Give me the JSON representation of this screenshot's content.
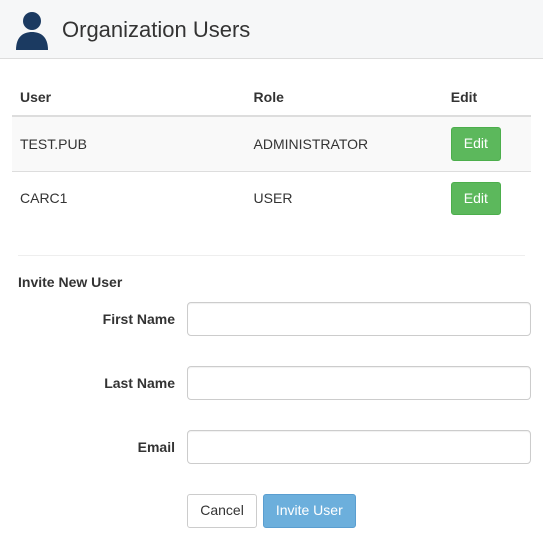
{
  "header": {
    "title": "Organization Users"
  },
  "table": {
    "columns": {
      "user": "User",
      "role": "Role",
      "edit": "Edit"
    },
    "rows": [
      {
        "user": "TEST.PUB",
        "role": "ADMINISTRATOR",
        "edit_label": "Edit"
      },
      {
        "user": "CARC1",
        "role": "USER",
        "edit_label": "Edit"
      }
    ]
  },
  "invite": {
    "title": "Invite New User",
    "first_name_label": "First Name",
    "last_name_label": "Last Name",
    "email_label": "Email",
    "first_name_value": "",
    "last_name_value": "",
    "email_value": "",
    "cancel_label": "Cancel",
    "submit_label": "Invite User"
  }
}
